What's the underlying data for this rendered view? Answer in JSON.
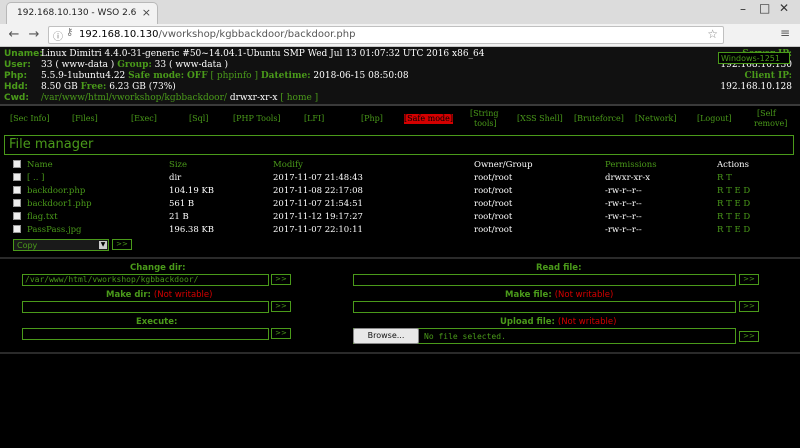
{
  "browser": {
    "tab_title": "192.168.10.130 - WSO 2.6",
    "tab_close": "×",
    "url_host": "192.168.10.130",
    "url_path": "/vworkshop/kgbbackdoor/backdoor.php",
    "icons": [
      "back-arrow-icon",
      "forward-arrow-icon",
      "info-icon",
      "lock-icon",
      "star-icon",
      "menu-icon",
      "minimize-icon",
      "maximize-icon",
      "close-icon"
    ]
  },
  "header": {
    "uname_label": "Uname:",
    "uname_value": "Linux Dimitri 4.4.0-31-generic #50~14.04.1-Ubuntu SMP Wed Jul 13 01:07:32 UTC 2016 x86_64",
    "user_label": "User:",
    "user_value": "33 ( www-data )",
    "group_label": "Group:",
    "group_value": "33 ( www-data )",
    "php_label": "Php:",
    "php_value": "5.5.9-1ubuntu4.22",
    "safe_mode_label": "Safe mode:",
    "safe_mode_value": "OFF",
    "phpinfo_link": "[ phpinfo ]",
    "datetime_label": "Datetime:",
    "datetime_value": "2018-06-15 08:50:08",
    "hdd_label": "Hdd:",
    "hdd_total": "8.50 GB",
    "free_label": "Free:",
    "hdd_free": "6.23 GB (73%)",
    "cwd_label": "Cwd:",
    "cwd_path": "/var/www/html/vworkshop/kgbbackdoor/",
    "cwd_perms": "drwxr-xr-x",
    "home_link": "[ home ]",
    "encoding": "Windows-1251",
    "server_ip_label": "Server IP:",
    "server_ip": "192.168.10.130",
    "client_ip_label": "Client IP:",
    "client_ip": "192.168.10.128",
    "colors": {
      "accent_green": "#4a9a1a",
      "warning_red": "#d40000"
    }
  },
  "menu": {
    "items": [
      "[Sec Info]",
      "[Files]",
      "[Exec]",
      "[Sql]",
      "[PHP Tools]",
      "[LFI]",
      "[Php]",
      "[Safe mode]",
      "[String",
      "tools]",
      "[XSS Shell]",
      "[Bruteforce]",
      "[Network]",
      "[Logout]",
      "[Self",
      "remove]"
    ]
  },
  "file_manager": {
    "title": "File manager",
    "columns": [
      "Name",
      "Size",
      "Modify",
      "Owner/Group",
      "Permissions",
      "Actions"
    ],
    "rows": [
      {
        "name": "[ .. ]",
        "size": "dir",
        "modify": "2017-11-07 21:48:43",
        "owner": "root/root",
        "perms": "drwxr-xr-x",
        "actions": "R T"
      },
      {
        "name": "backdoor.php",
        "size": "104.19 KB",
        "modify": "2017-11-08 22:17:08",
        "owner": "root/root",
        "perms": "-rw-r--r--",
        "actions": "R T E D"
      },
      {
        "name": "backdoor1.php",
        "size": "561 B",
        "modify": "2017-11-07 21:54:51",
        "owner": "root/root",
        "perms": "-rw-r--r--",
        "actions": "R T E D"
      },
      {
        "name": "flag.txt",
        "size": "21 B",
        "modify": "2017-11-12 19:17:27",
        "owner": "root/root",
        "perms": "-rw-r--r--",
        "actions": "R T E D"
      },
      {
        "name": "PassPass.jpg",
        "size": "196.38 KB",
        "modify": "2017-11-07 22:10:11",
        "owner": "root/root",
        "perms": "-rw-r--r--",
        "actions": "R T E D"
      }
    ],
    "action_select": "Copy",
    "go_label": ">>"
  },
  "tools": {
    "change_dir_label": "Change dir:",
    "change_dir_value": "/var/www/html/vworkshop/kgbbackdoor/",
    "make_dir_label": "Make dir:",
    "make_dir_note": "(Not writable)",
    "execute_label": "Execute:",
    "read_file_label": "Read file:",
    "make_file_label": "Make file:",
    "make_file_note": "(Not writable)",
    "upload_label": "Upload file:",
    "upload_note": "(Not writable)",
    "browse_label": "Browse...",
    "no_file": "No file selected.",
    "go_label": ">>"
  }
}
